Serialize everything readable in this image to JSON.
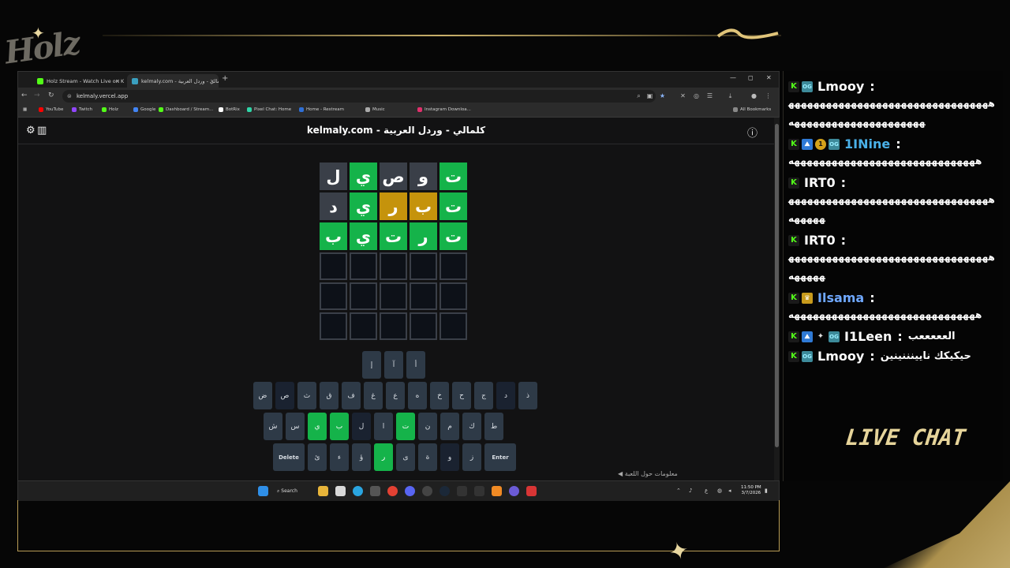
{
  "overlay": {
    "logo_text": "Holz",
    "live_chat_label": "LIVE CHAT"
  },
  "browser": {
    "tabs": [
      {
        "title": "Holz Stream - Watch Live on Ki",
        "favicon_color": "#53fc18",
        "active": false
      },
      {
        "title": "kelmaly.com - كلمالي - وردل العربية",
        "favicon_color": "#3a9fbf",
        "active": true
      }
    ],
    "new_tab": "+",
    "url": "kelmaly.vercel.app",
    "bookmarks": [
      {
        "label": "YouTube",
        "color": "#ff0000"
      },
      {
        "label": "Twitch",
        "color": "#9146ff"
      },
      {
        "label": "Holz",
        "color": "#53fc18"
      },
      {
        "label": "Google",
        "color": "#4285f4"
      },
      {
        "label": "Dashboard / Stream...",
        "color": "#53fc18"
      },
      {
        "label": "BotRix",
        "color": "#ffffff"
      },
      {
        "label": "Pixel Chat: Home",
        "color": "#2fd6a8"
      },
      {
        "label": "Home - Restream",
        "color": "#2f6fd6"
      },
      {
        "label": "Music",
        "color": "#aaaaaa"
      },
      {
        "label": "Instagram Downloa...",
        "color": "#e1306c"
      }
    ],
    "all_bookmarks": "All Bookmarks"
  },
  "game": {
    "title": "kelmaly.com - كلمالي - وردل العربية",
    "grid": [
      [
        {
          "l": "ت",
          "s": "correct"
        },
        {
          "l": "و",
          "s": "absent"
        },
        {
          "l": "ص",
          "s": "absent"
        },
        {
          "l": "ي",
          "s": "correct"
        },
        {
          "l": "ل",
          "s": "absent"
        }
      ],
      [
        {
          "l": "ت",
          "s": "correct"
        },
        {
          "l": "ب",
          "s": "present"
        },
        {
          "l": "ر",
          "s": "present"
        },
        {
          "l": "ي",
          "s": "correct"
        },
        {
          "l": "د",
          "s": "absent"
        }
      ],
      [
        {
          "l": "ت",
          "s": "correct"
        },
        {
          "l": "ر",
          "s": "correct"
        },
        {
          "l": "ت",
          "s": "correct"
        },
        {
          "l": "ي",
          "s": "correct"
        },
        {
          "l": "ب",
          "s": "correct"
        }
      ],
      [
        {
          "l": "",
          "s": "empty"
        },
        {
          "l": "",
          "s": "empty"
        },
        {
          "l": "",
          "s": "empty"
        },
        {
          "l": "",
          "s": "empty"
        },
        {
          "l": "",
          "s": "empty"
        }
      ],
      [
        {
          "l": "",
          "s": "empty"
        },
        {
          "l": "",
          "s": "empty"
        },
        {
          "l": "",
          "s": "empty"
        },
        {
          "l": "",
          "s": "empty"
        },
        {
          "l": "",
          "s": "empty"
        }
      ],
      [
        {
          "l": "",
          "s": "empty"
        },
        {
          "l": "",
          "s": "empty"
        },
        {
          "l": "",
          "s": "empty"
        },
        {
          "l": "",
          "s": "empty"
        },
        {
          "l": "",
          "s": "empty"
        }
      ]
    ],
    "keyboard": [
      [
        {
          "k": "أ"
        },
        {
          "k": "آ"
        },
        {
          "k": "إ"
        }
      ],
      [
        {
          "k": "ذ"
        },
        {
          "k": "د",
          "s": "absent"
        },
        {
          "k": "ج"
        },
        {
          "k": "ح"
        },
        {
          "k": "خ"
        },
        {
          "k": "ه"
        },
        {
          "k": "ع"
        },
        {
          "k": "غ"
        },
        {
          "k": "ف"
        },
        {
          "k": "ق"
        },
        {
          "k": "ث"
        },
        {
          "k": "ص",
          "s": "absent"
        },
        {
          "k": "ض"
        }
      ],
      [
        {
          "k": "ط"
        },
        {
          "k": "ك"
        },
        {
          "k": "م"
        },
        {
          "k": "ن"
        },
        {
          "k": "ت",
          "s": "correct"
        },
        {
          "k": "ا"
        },
        {
          "k": "ل",
          "s": "absent"
        },
        {
          "k": "ب",
          "s": "correct"
        },
        {
          "k": "ي",
          "s": "correct"
        },
        {
          "k": "س"
        },
        {
          "k": "ش"
        }
      ],
      [
        {
          "k": "Enter",
          "wide": true
        },
        {
          "k": "ز"
        },
        {
          "k": "و",
          "s": "absent"
        },
        {
          "k": "ة"
        },
        {
          "k": "ى"
        },
        {
          "k": "ر",
          "s": "correct"
        },
        {
          "k": "ؤ"
        },
        {
          "k": "ء"
        },
        {
          "k": "ئ"
        },
        {
          "k": "Delete",
          "wide": true
        }
      ]
    ],
    "bottom_hint": "◀ معلومات حول اللعبة"
  },
  "taskbar": {
    "search_label": "Search",
    "time": "11:50 PM",
    "date": "3/7/2026",
    "lang": "ع"
  },
  "chat": {
    "messages": [
      {
        "user": "Lmooy",
        "user_color": "#ffffff",
        "badges": [
          "k",
          "og"
        ],
        "text": "ههههههههههههههههههههههههههههههههههههههههههههههههههههههه"
      },
      {
        "user": "1INine",
        "user_color": "#4ab0e8",
        "badges": [
          "k",
          "sub",
          "gift",
          "og"
        ],
        "text": "ههههههههههههههههههههههههههههههه"
      },
      {
        "user": "IRT0",
        "user_color": "#ffffff",
        "badges": [
          "k"
        ],
        "text": "ههههههههههههههههههههههههههههههههههههههه"
      },
      {
        "user": "IRT0",
        "user_color": "#ffffff",
        "badges": [
          "k"
        ],
        "text": "ههههههههههههههههههههههههههههههههههههههه"
      },
      {
        "user": "Ilsama",
        "user_color": "#6fa8ff",
        "badges": [
          "k",
          "crown"
        ],
        "text": "ههههههههههههههههههههههههههههههه"
      },
      {
        "user": "I1Leen",
        "user_color": "#ffffff",
        "badges": [
          "k",
          "sub",
          "wand",
          "og"
        ],
        "text": "العععععب",
        "inline": true
      },
      {
        "user": "Lmooy",
        "user_color": "#ffffff",
        "badges": [
          "k",
          "og"
        ],
        "text": "حيكيكك نايينننينين",
        "inline": true
      }
    ]
  }
}
